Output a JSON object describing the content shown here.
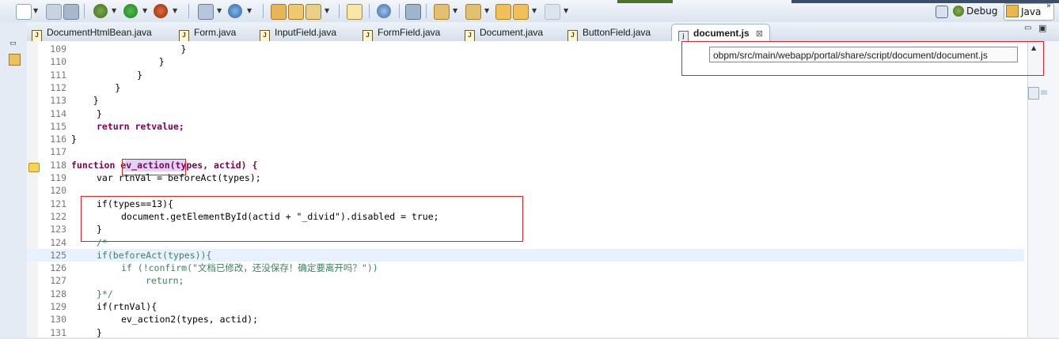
{
  "toolbar": {
    "perspectives": [
      {
        "label": "Debug"
      },
      {
        "label": "Java"
      }
    ]
  },
  "tabs": [
    {
      "label": "DocumentHtmlBean.java"
    },
    {
      "label": "Form.java"
    },
    {
      "label": "InputField.java"
    },
    {
      "label": "FormField.java"
    },
    {
      "label": "Document.java"
    },
    {
      "label": "ButtonField.java"
    },
    {
      "label": "document.js",
      "active": true
    }
  ],
  "tooltip": {
    "text": "obpm/src/main/webapp/portal/share/script/document/document.js"
  },
  "editor": {
    "lines": [
      {
        "n": "109",
        "code": "                    }"
      },
      {
        "n": "110",
        "code": "                }"
      },
      {
        "n": "111",
        "code": "            }"
      },
      {
        "n": "112",
        "code": "        }"
      },
      {
        "n": "113",
        "code": "    }"
      },
      {
        "n": "114",
        "code": "}"
      },
      {
        "n": "115",
        "code": "return retvalue;"
      },
      {
        "n": "116",
        "code": "}"
      },
      {
        "n": "117",
        "code": ""
      },
      {
        "n": "118",
        "code": "function ev_action(types, actid) {"
      },
      {
        "n": "119",
        "code": "var rtnVal = beforeAct(types);"
      },
      {
        "n": "120",
        "code": ""
      },
      {
        "n": "121",
        "code": "if(types==13){"
      },
      {
        "n": "122",
        "code": "document.getElementById(actid + \"_divid\").disabled = true;"
      },
      {
        "n": "123",
        "code": "}"
      },
      {
        "n": "124",
        "code": "/*"
      },
      {
        "n": "125",
        "code": "if(beforeAct(types)){"
      },
      {
        "n": "126",
        "code": "if (!confirm(\"文档已修改，还没保存！确定要离开吗？\"))"
      },
      {
        "n": "127",
        "code": "return;"
      },
      {
        "n": "128",
        "code": "}*/"
      },
      {
        "n": "129",
        "code": "if(rtnVal){"
      },
      {
        "n": "130",
        "code": "ev_action2(types, actid);"
      },
      {
        "n": "131",
        "code": "}"
      }
    ]
  }
}
